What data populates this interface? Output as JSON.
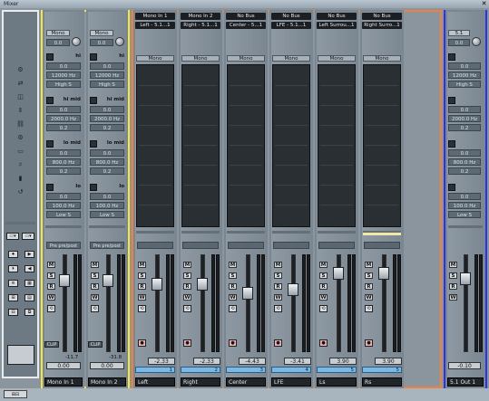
{
  "window": {
    "title": "Mixer",
    "close_glyph": "✕"
  },
  "common_panel": {
    "icons": [
      "tools-icon",
      "routing-icon",
      "view-icon",
      "expand-icon",
      "link-icon",
      "settings-icon",
      "bus-icon",
      "fx-icon",
      "meter-icon",
      "reset-icon"
    ],
    "lower_buttons": [
      "⏺",
      "▶",
      "⏵",
      "◀",
      "≡",
      "▦",
      "⊞",
      "▤",
      "⊟",
      "⧉"
    ],
    "bottom_labels": [
      "B"
    ]
  },
  "input_channels": [
    {
      "route": "Mono",
      "pan": "0.0",
      "eq": [
        {
          "band": "hi",
          "gain": "0.0",
          "freq": "12000 Hz",
          "q": "High S"
        },
        {
          "band": "hi mid",
          "gain": "0.0",
          "freq": "2000.0 Hz",
          "q": "0.2"
        },
        {
          "band": "lo mid",
          "gain": "0.0",
          "freq": "800.0 Hz",
          "q": "0.2"
        },
        {
          "band": "lo",
          "gain": "0.0",
          "freq": "100.0 Hz",
          "q": "Low S"
        }
      ],
      "inserts_label": "Pre pre/post",
      "volume": "0.00",
      "peak": "-11.7",
      "clip": "CLIP",
      "name": "Mono In 1"
    },
    {
      "route": "Mono",
      "pan": "0.0",
      "eq": [
        {
          "band": "hi",
          "gain": "0.0",
          "freq": "12000 Hz",
          "q": "High S"
        },
        {
          "band": "hi mid",
          "gain": "0.0",
          "freq": "2000.0 Hz",
          "q": "0.2"
        },
        {
          "band": "lo mid",
          "gain": "0.0",
          "freq": "800.0 Hz",
          "q": "0.2"
        },
        {
          "band": "lo",
          "gain": "0.0",
          "freq": "100.0 Hz",
          "q": "Low S"
        }
      ],
      "inserts_label": "Pre pre/post",
      "volume": "0.00",
      "peak": "-31.8",
      "clip": "CLIP",
      "name": "Mono In 2"
    }
  ],
  "audio_channels": [
    {
      "route_in": "Mono In 1",
      "route_out": "Left - 5.1...1",
      "pan": "Mono",
      "volume": "-2.33",
      "number": "1",
      "name": "Left"
    },
    {
      "route_in": "Mono In 2",
      "route_out": "Right - 5.1...1",
      "pan": "Mono",
      "volume": "-2.33",
      "number": "2",
      "name": "Right"
    },
    {
      "route_in": "No Bus",
      "route_out": "Center - 5...1",
      "pan": "Mono",
      "volume": "-4.43",
      "number": "3",
      "name": "Center"
    },
    {
      "route_in": "No Bus",
      "route_out": "LFE - 5.1...1",
      "pan": "Mono",
      "volume": "-3.41",
      "number": "4",
      "name": "LFE"
    },
    {
      "route_in": "No Bus",
      "route_out": "Left Surrou...1",
      "pan": "Mono",
      "volume": "3.90",
      "number": "5",
      "name": "Ls"
    },
    {
      "route_in": "No Bus",
      "route_out": "Right Surro...1",
      "pan": "Mono",
      "volume": "3.90",
      "number": "5",
      "name": "Rs"
    }
  ],
  "output_channel": {
    "route": "5.1",
    "pan": "0.0",
    "eq": [
      {
        "gain": "0.0",
        "freq": "12000 Hz",
        "q": "High S"
      },
      {
        "gain": "0.0",
        "freq": "2000.0 Hz",
        "q": "0.2"
      },
      {
        "gain": "0.0",
        "freq": "800.0 Hz",
        "q": "0.2"
      },
      {
        "gain": "0.0",
        "freq": "100.0 Hz",
        "q": "Low S"
      }
    ],
    "volume": "-0.10",
    "name": "5.1 Out 1"
  },
  "channel_buttons": {
    "mute": "M",
    "solo": "S",
    "read": "R",
    "write": "W"
  },
  "colors": {
    "input_frame": "#f4e542",
    "channel_frame": "#f0803c",
    "output_frame": "#2b33e6",
    "common_frame": "#e8ecef"
  }
}
